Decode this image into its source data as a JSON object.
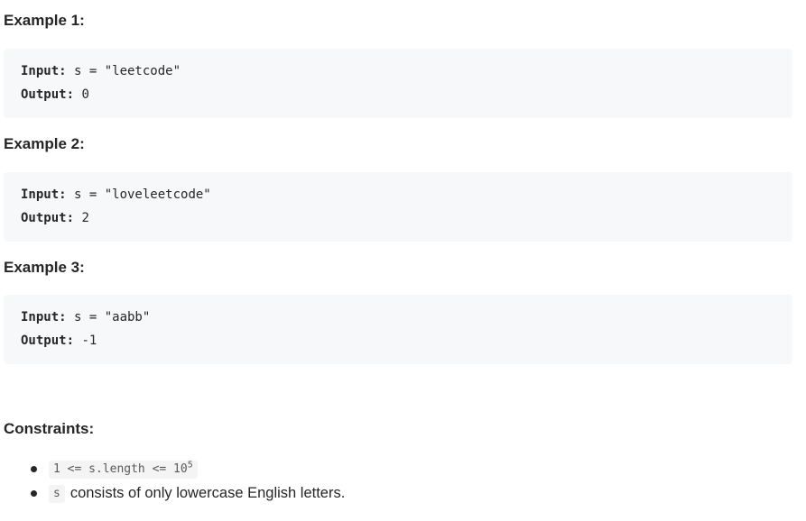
{
  "examples": [
    {
      "heading": "Example 1:",
      "input_label": "Input:",
      "input_value": " s = \"leetcode\"",
      "output_label": "Output:",
      "output_value": " 0"
    },
    {
      "heading": "Example 2:",
      "input_label": "Input:",
      "input_value": " s = \"loveleetcode\"",
      "output_label": "Output:",
      "output_value": " 2"
    },
    {
      "heading": "Example 3:",
      "input_label": "Input:",
      "input_value": " s = \"aabb\"",
      "output_label": "Output:",
      "output_value": " -1"
    }
  ],
  "constraints": {
    "heading": "Constraints:",
    "items": [
      {
        "code": "1 <= s.length <= 10",
        "superscript": "5"
      },
      {
        "code": "s",
        "text": "consists of only lowercase English letters."
      }
    ]
  }
}
